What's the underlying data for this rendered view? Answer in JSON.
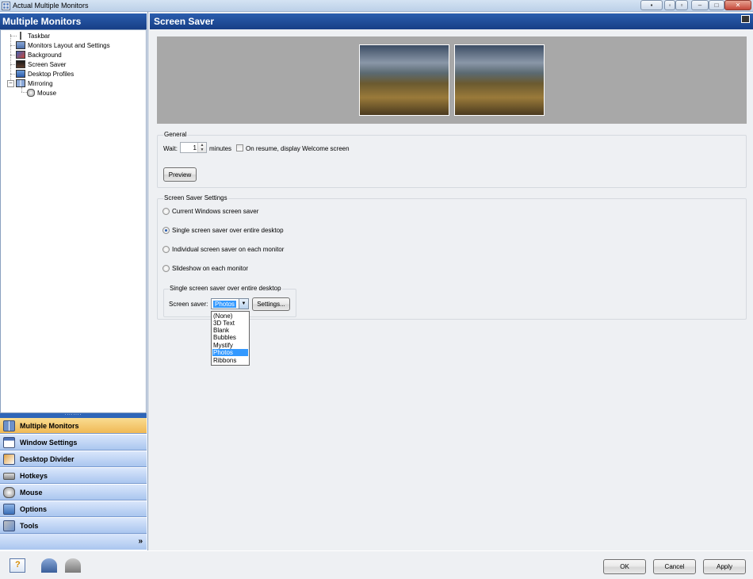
{
  "window": {
    "title": "Actual Multiple Monitors"
  },
  "sidebar": {
    "header": "Multiple Monitors",
    "tree": [
      {
        "label": "Taskbar"
      },
      {
        "label": "Monitors Layout and Settings"
      },
      {
        "label": "Background"
      },
      {
        "label": "Screen Saver"
      },
      {
        "label": "Desktop Profiles"
      },
      {
        "label": "Mirroring"
      },
      {
        "label": "Mouse"
      }
    ],
    "splitter_grip": "........",
    "nav": [
      {
        "label": "Multiple Monitors",
        "active": true
      },
      {
        "label": "Window Settings"
      },
      {
        "label": "Desktop Divider"
      },
      {
        "label": "Hotkeys"
      },
      {
        "label": "Mouse"
      },
      {
        "label": "Options"
      },
      {
        "label": "Tools"
      }
    ],
    "expand_glyph": "»"
  },
  "main": {
    "header": "Screen Saver",
    "general": {
      "title": "General",
      "wait_label": "Wait:",
      "wait_value": "1",
      "minutes_label": "minutes",
      "resume_label": "On resume, display Welcome screen",
      "resume_checked": false,
      "preview_button": "Preview"
    },
    "settings": {
      "title": "Screen Saver Settings",
      "options": [
        {
          "label": "Current Windows screen saver",
          "selected": false
        },
        {
          "label": "Single screen saver over entire desktop",
          "selected": true
        },
        {
          "label": "Individual screen saver on each monitor",
          "selected": false
        },
        {
          "label": "Slideshow on each monitor",
          "selected": false
        }
      ],
      "sub_title": "Single screen saver over entire desktop",
      "saver_label": "Screen saver:",
      "saver_value": "Photos",
      "settings_button": "Settings...",
      "dropdown_options": [
        "(None)",
        "3D Text",
        "Blank",
        "Bubbles",
        "Mystify",
        "Photos",
        "Ribbons"
      ],
      "dropdown_highlighted": "Photos"
    }
  },
  "footer": {
    "ok": "OK",
    "cancel": "Cancel",
    "apply": "Apply"
  },
  "colors": {
    "header_blue": "#1f4b99",
    "active_nav": "#f0b955",
    "nav_blue": "#aac6ef"
  }
}
